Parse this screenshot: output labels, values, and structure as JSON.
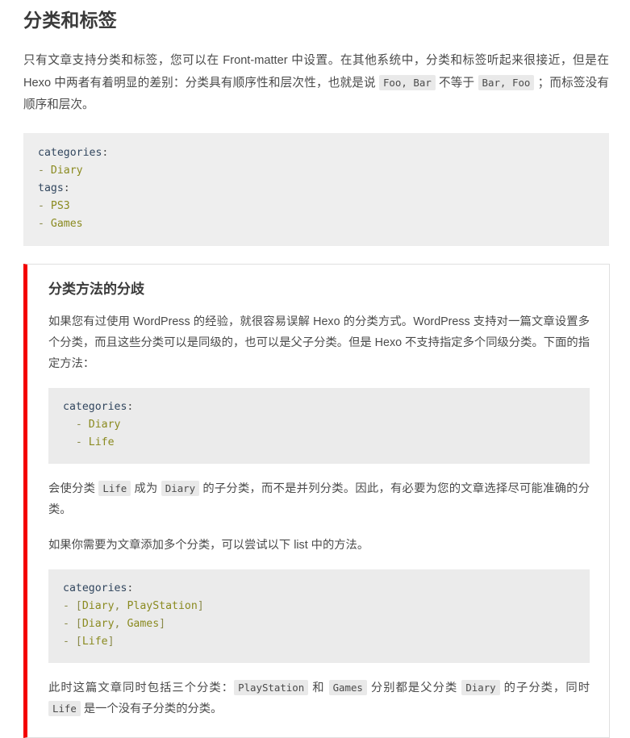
{
  "page": {
    "title": "分类和标签",
    "intro_paragraph": {
      "segments": [
        {
          "type": "text",
          "value": "只有文章支持分类和标签，您可以在 Front-matter 中设置。在其他系统中，分类和标签听起来很接近，但是在 Hexo 中两者有着明显的差别：分类具有顺序性和层次性，也就是说 "
        },
        {
          "type": "code",
          "value": "Foo, Bar"
        },
        {
          "type": "text",
          "value": " 不等于 "
        },
        {
          "type": "code",
          "value": "Bar, Foo"
        },
        {
          "type": "text",
          "value": " ；而标签没有顺序和层次。"
        }
      ]
    },
    "code_block_front_matter": {
      "language": "yaml",
      "lines": [
        [
          {
            "t": "key",
            "v": "categories"
          },
          {
            "t": "punct",
            "v": ":"
          }
        ],
        [
          {
            "t": "dash",
            "v": "- "
          },
          {
            "t": "val",
            "v": "Diary"
          }
        ],
        [
          {
            "t": "key",
            "v": "tags"
          },
          {
            "t": "punct",
            "v": ":"
          }
        ],
        [
          {
            "t": "dash",
            "v": "- "
          },
          {
            "t": "val",
            "v": "PS3"
          }
        ],
        [
          {
            "t": "dash",
            "v": "- "
          },
          {
            "t": "val",
            "v": "Games"
          }
        ]
      ]
    },
    "note": {
      "accent_color": "#f40000",
      "title": "分类方法的分歧",
      "paragraph_1": "如果您有过使用 WordPress 的经验，就很容易误解 Hexo 的分类方式。WordPress 支持对一篇文章设置多个分类，而且这些分类可以是同级的，也可以是父子分类。但是 Hexo 不支持指定多个同级分类。下面的指定方法：",
      "code_block_nested": {
        "language": "yaml",
        "lines": [
          [
            {
              "t": "key",
              "v": "categories"
            },
            {
              "t": "punct",
              "v": ":"
            }
          ],
          [
            {
              "t": "plain",
              "v": "  "
            },
            {
              "t": "dash",
              "v": "- "
            },
            {
              "t": "val",
              "v": "Diary"
            }
          ],
          [
            {
              "t": "plain",
              "v": "  "
            },
            {
              "t": "dash",
              "v": "- "
            },
            {
              "t": "val",
              "v": "Life"
            }
          ]
        ]
      },
      "paragraph_2": {
        "segments": [
          {
            "type": "text",
            "value": "会使分类 "
          },
          {
            "type": "code",
            "value": "Life"
          },
          {
            "type": "text",
            "value": " 成为 "
          },
          {
            "type": "code",
            "value": "Diary"
          },
          {
            "type": "text",
            "value": " 的子分类，而不是并列分类。因此，有必要为您的文章选择尽可能准确的分类。"
          }
        ]
      },
      "paragraph_3": "如果你需要为文章添加多个分类，可以尝试以下 list 中的方法。",
      "code_block_list": {
        "language": "yaml",
        "lines": [
          [
            {
              "t": "key",
              "v": "categories"
            },
            {
              "t": "punct",
              "v": ":"
            }
          ],
          [
            {
              "t": "dash",
              "v": "- "
            },
            {
              "t": "bracket",
              "v": "["
            },
            {
              "t": "val",
              "v": "Diary"
            },
            {
              "t": "bracket",
              "v": ", "
            },
            {
              "t": "val",
              "v": "PlayStation"
            },
            {
              "t": "bracket",
              "v": "]"
            }
          ],
          [
            {
              "t": "dash",
              "v": "- "
            },
            {
              "t": "bracket",
              "v": "["
            },
            {
              "t": "val",
              "v": "Diary"
            },
            {
              "t": "bracket",
              "v": ", "
            },
            {
              "t": "val",
              "v": "Games"
            },
            {
              "t": "bracket",
              "v": "]"
            }
          ],
          [
            {
              "t": "dash",
              "v": "- "
            },
            {
              "t": "bracket",
              "v": "["
            },
            {
              "t": "val",
              "v": "Life"
            },
            {
              "t": "bracket",
              "v": "]"
            }
          ]
        ]
      },
      "paragraph_4": {
        "segments": [
          {
            "type": "text",
            "value": "此时这篇文章同时包括三个分类："
          },
          {
            "type": "code",
            "value": "PlayStation"
          },
          {
            "type": "text",
            "value": " 和 "
          },
          {
            "type": "code",
            "value": "Games"
          },
          {
            "type": "text",
            "value": " 分别都是父分类 "
          },
          {
            "type": "code",
            "value": "Diary"
          },
          {
            "type": "text",
            "value": " 的子分类，同时 "
          },
          {
            "type": "code",
            "value": "Life"
          },
          {
            "type": "text",
            "value": " 是一个没有子分类的分类。"
          }
        ]
      }
    }
  }
}
